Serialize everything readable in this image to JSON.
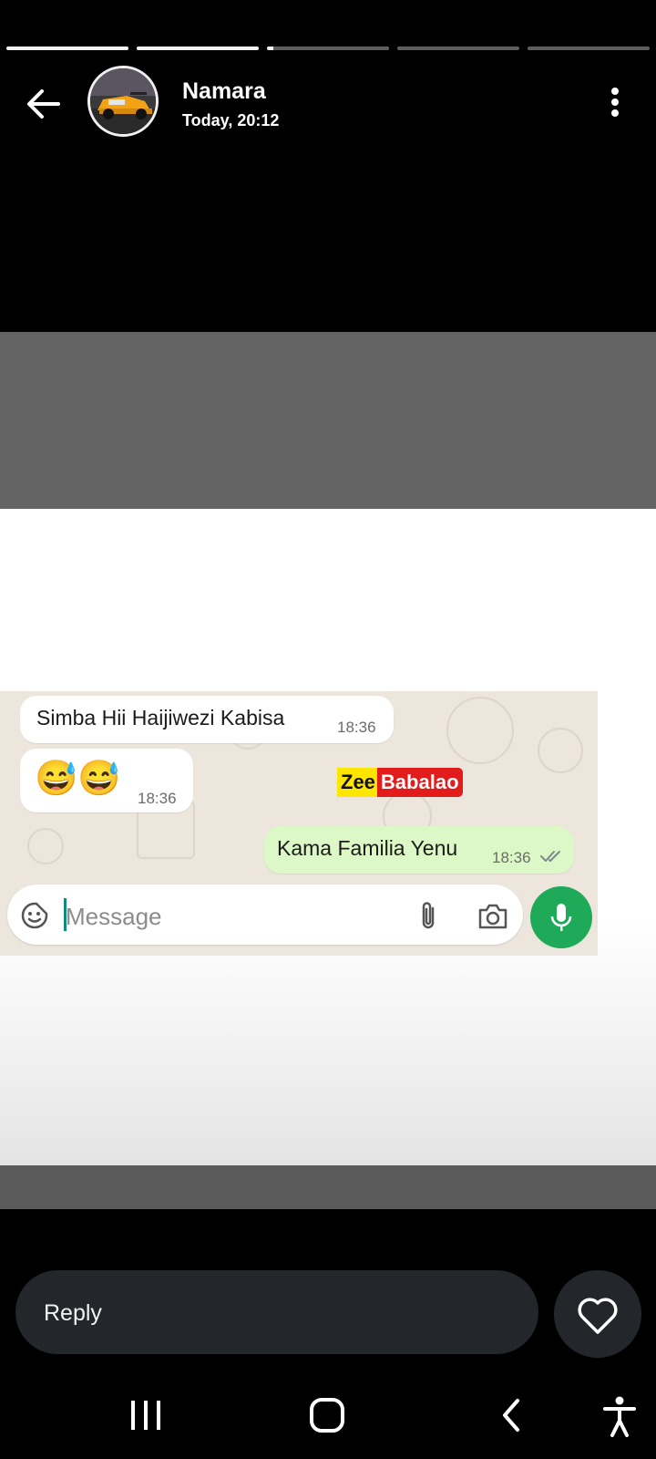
{
  "story": {
    "progress_segments": [
      1,
      1,
      0.05,
      0,
      0
    ],
    "author": "Namara",
    "timestamp": "Today, 20:12"
  },
  "chat_screenshot": {
    "messages": [
      {
        "direction": "incoming",
        "text": "Simba Hii Haijiwezi Kabisa",
        "time": "18:36"
      },
      {
        "direction": "incoming",
        "text": "😅😅",
        "time": "18:36"
      },
      {
        "direction": "outgoing",
        "text": "Kama Familia Yenu",
        "time": "18:36",
        "status": "double-check-icon"
      }
    ],
    "watermark": {
      "part1": "Zee",
      "part2": "Babalao"
    },
    "input_placeholder": "Message"
  },
  "reply": {
    "placeholder": "Reply"
  },
  "icons": {
    "back": "arrow-left-icon",
    "more": "more-vertical-icon",
    "like": "heart-icon",
    "nav": [
      "recent-apps-icon",
      "home-icon",
      "back-chevron-icon",
      "accessibility-icon"
    ]
  },
  "colors": {
    "progress_active": "#f2f2f2",
    "progress_inactive": "#5e5e5e",
    "reply_bg": "#23272b",
    "bubble_out": "#dcf8c6",
    "mic_green": "#1faa59",
    "watermark_yellow": "#ffe600",
    "watermark_red": "#e21b1b"
  }
}
